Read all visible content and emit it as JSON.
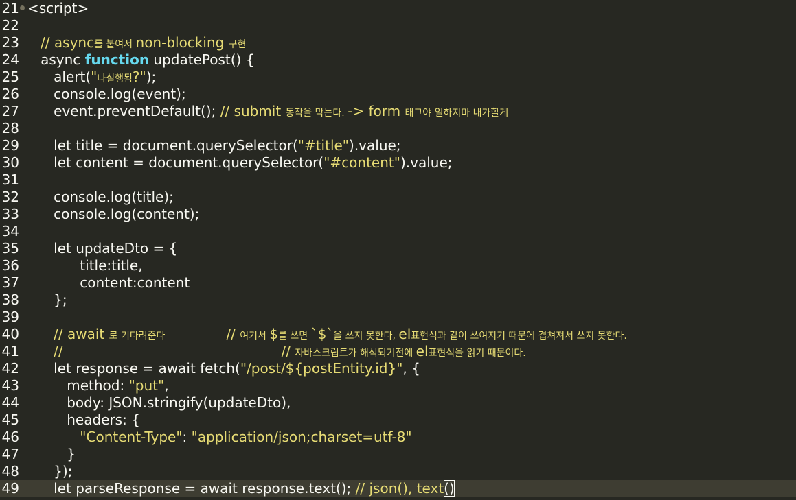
{
  "editor": {
    "theme_colors": {
      "background": "#272822",
      "current_line": "#3e3d32",
      "text": "#f8f8f2",
      "keyword": "#66d9ef",
      "string": "#e6db74",
      "comment": "#e6db74"
    },
    "lines": [
      {
        "num": "21",
        "fold": true,
        "tokens": [
          {
            "t": "tag",
            "v": "<script>"
          }
        ]
      },
      {
        "num": "22",
        "tokens": []
      },
      {
        "num": "23",
        "tokens": [
          {
            "t": "comment",
            "v": "   // async"
          },
          {
            "t": "comment-small",
            "v": "를 붙여서 "
          },
          {
            "t": "comment",
            "v": "non-blocking "
          },
          {
            "t": "comment-small",
            "v": "구현"
          }
        ]
      },
      {
        "num": "24",
        "tokens": [
          {
            "t": "plain",
            "v": "   async "
          },
          {
            "t": "kw",
            "v": "function"
          },
          {
            "t": "plain",
            "v": " updatePost() {"
          }
        ]
      },
      {
        "num": "25",
        "tokens": [
          {
            "t": "plain",
            "v": "      alert("
          },
          {
            "t": "str",
            "v": "\""
          },
          {
            "t": "comment-small",
            "v": "나실행됨"
          },
          {
            "t": "str",
            "v": "?\""
          },
          {
            "t": "plain",
            "v": ");"
          }
        ]
      },
      {
        "num": "26",
        "tokens": [
          {
            "t": "plain",
            "v": "      console.log(event);"
          }
        ]
      },
      {
        "num": "27",
        "tokens": [
          {
            "t": "plain",
            "v": "      event.preventDefault(); "
          },
          {
            "t": "comment",
            "v": "// submit "
          },
          {
            "t": "comment-small",
            "v": "동작을 막는다. "
          },
          {
            "t": "comment",
            "v": "-> form "
          },
          {
            "t": "comment-small",
            "v": "태그야 일하지마 내가할게"
          }
        ]
      },
      {
        "num": "28",
        "tokens": []
      },
      {
        "num": "29",
        "tokens": [
          {
            "t": "plain",
            "v": "      let title = document.querySelector("
          },
          {
            "t": "str",
            "v": "\"#title\""
          },
          {
            "t": "plain",
            "v": ").value;"
          }
        ]
      },
      {
        "num": "30",
        "tokens": [
          {
            "t": "plain",
            "v": "      let content = document.querySelector("
          },
          {
            "t": "str",
            "v": "\"#content\""
          },
          {
            "t": "plain",
            "v": ").value;"
          }
        ]
      },
      {
        "num": "31",
        "tokens": []
      },
      {
        "num": "32",
        "tokens": [
          {
            "t": "plain",
            "v": "      console.log(title);"
          }
        ]
      },
      {
        "num": "33",
        "tokens": [
          {
            "t": "plain",
            "v": "      console.log(content);"
          }
        ]
      },
      {
        "num": "34",
        "tokens": []
      },
      {
        "num": "35",
        "tokens": [
          {
            "t": "plain",
            "v": "      let updateDto = {"
          }
        ]
      },
      {
        "num": "36",
        "tokens": [
          {
            "t": "plain",
            "v": "            title:title,"
          }
        ]
      },
      {
        "num": "37",
        "tokens": [
          {
            "t": "plain",
            "v": "            content:content"
          }
        ]
      },
      {
        "num": "38",
        "tokens": [
          {
            "t": "plain",
            "v": "      };"
          }
        ]
      },
      {
        "num": "39",
        "tokens": []
      },
      {
        "num": "40",
        "tokens": [
          {
            "t": "comment",
            "v": "      // await "
          },
          {
            "t": "comment-small",
            "v": "로 기다려준다                    "
          },
          {
            "t": "comment",
            "v": "// "
          },
          {
            "t": "comment-small",
            "v": "여기서 "
          },
          {
            "t": "comment",
            "v": "$"
          },
          {
            "t": "comment-small",
            "v": "를 쓰면 "
          },
          {
            "t": "comment",
            "v": "`$`"
          },
          {
            "t": "comment-small",
            "v": "을 쓰지 못한다, "
          },
          {
            "t": "comment",
            "v": "el"
          },
          {
            "t": "comment-small",
            "v": "표현식과 같이 쓰여지기 때문에 겹쳐져서 쓰지 못한다."
          }
        ]
      },
      {
        "num": "41",
        "tokens": [
          {
            "t": "comment",
            "v": "      //                                                  // "
          },
          {
            "t": "comment-small",
            "v": "자바스크립트가 해석되기전에 "
          },
          {
            "t": "comment",
            "v": "el"
          },
          {
            "t": "comment-small",
            "v": "표현식을 읽기 때문이다."
          }
        ]
      },
      {
        "num": "42",
        "tokens": [
          {
            "t": "plain",
            "v": "      let response = await fetch("
          },
          {
            "t": "str",
            "v": "\"/post/${postEntity.id}\""
          },
          {
            "t": "plain",
            "v": ", {"
          }
        ]
      },
      {
        "num": "43",
        "tokens": [
          {
            "t": "plain",
            "v": "         method: "
          },
          {
            "t": "str",
            "v": "\"put\""
          },
          {
            "t": "plain",
            "v": ","
          }
        ]
      },
      {
        "num": "44",
        "tokens": [
          {
            "t": "plain",
            "v": "         body: JSON.stringify(updateDto),"
          }
        ]
      },
      {
        "num": "45",
        "tokens": [
          {
            "t": "plain",
            "v": "         headers: {"
          }
        ]
      },
      {
        "num": "46",
        "tokens": [
          {
            "t": "str",
            "v": "            \"Content-Type\""
          },
          {
            "t": "plain",
            "v": ": "
          },
          {
            "t": "str",
            "v": "\"application/json;charset=utf-8\""
          }
        ]
      },
      {
        "num": "47",
        "tokens": [
          {
            "t": "plain",
            "v": "         }"
          }
        ]
      },
      {
        "num": "48",
        "tokens": [
          {
            "t": "plain",
            "v": "      });"
          }
        ]
      },
      {
        "num": "49",
        "current": true,
        "tokens": [
          {
            "t": "plain",
            "v": "      let parseResponse = await response.text(); "
          },
          {
            "t": "comment",
            "v": "// json(), text"
          },
          {
            "t": "cursor",
            "v": "()"
          }
        ]
      }
    ]
  }
}
